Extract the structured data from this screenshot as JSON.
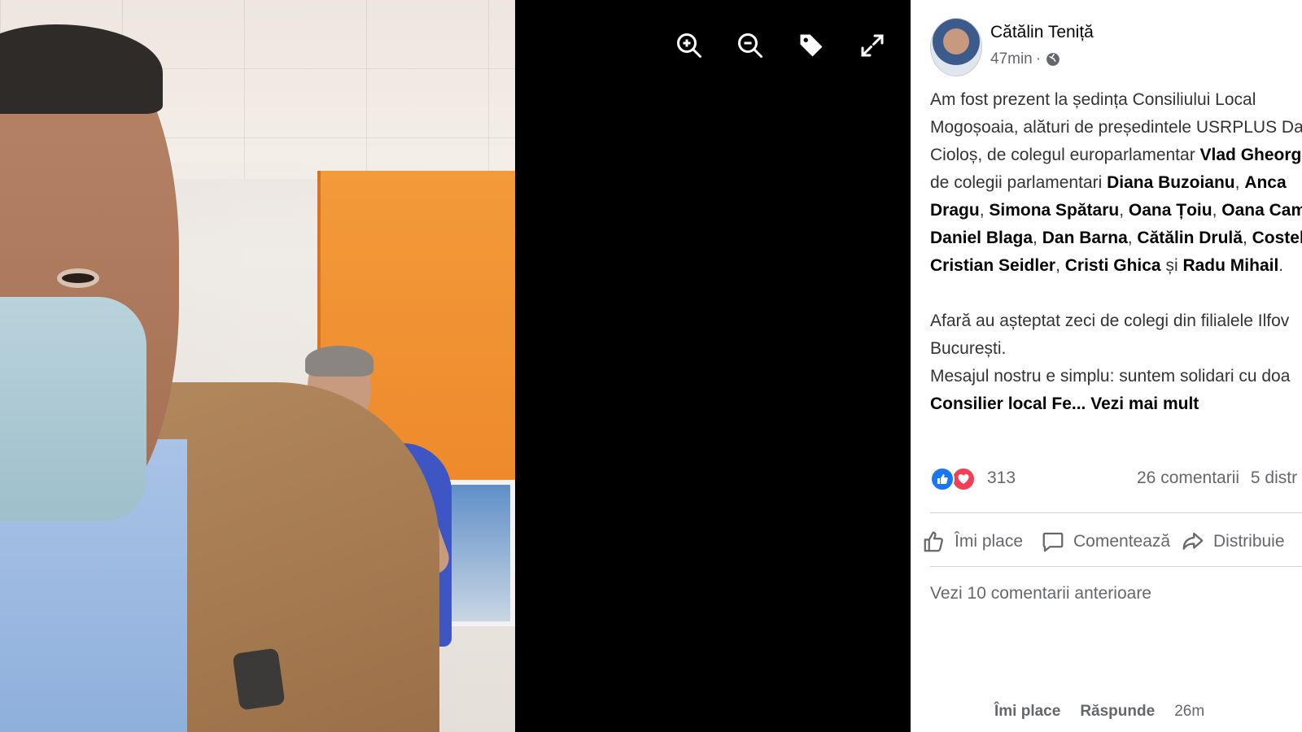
{
  "viewer": {
    "tools": [
      {
        "name": "zoom-in-icon"
      },
      {
        "name": "zoom-out-icon"
      },
      {
        "name": "tag-icon"
      },
      {
        "name": "fullscreen-icon"
      }
    ]
  },
  "post": {
    "author": "Cătălin Teniță",
    "time": "47min",
    "separator": "·",
    "privacy_icon": "globe-icon",
    "text": {
      "p1_l1": "Am fost prezent la ședința Consiliului Local",
      "p1_l2a": "Mogoșoaia, alături de președintele USRPLUS Da",
      "p1_l3a": "Cioloș, de colegul europarlamentar ",
      "p1_l3b": "Vlad Gheorg",
      "p1_l4a": "de colegii parlamentari ",
      "p1_l4b": "Diana Buzoianu",
      "p1_l4c": ", ",
      "p1_l4d": "Anca",
      "p1_l5a": "Dragu",
      "p1_l5b": ", ",
      "p1_l5c": "Simona Spătaru",
      "p1_l5d": ", ",
      "p1_l5e": "Oana Țoiu",
      "p1_l5f": ", ",
      "p1_l5g": "Oana Camb",
      "p1_l6a": "Daniel Blaga",
      "p1_l6b": ", ",
      "p1_l6c": "Dan Barna",
      "p1_l6d": ", ",
      "p1_l6e": "Cătălin Drulă",
      "p1_l6f": ", ",
      "p1_l6g": "Costel V",
      "p1_l7a": "Cristian Seidler",
      "p1_l7b": ", ",
      "p1_l7c": "Cristi Ghica",
      "p1_l7d": " și ",
      "p1_l7e": "Radu Mihail",
      "p1_l7f": ".",
      "p2_l1": "Afară au așteptat zeci de colegi din filialele Ilfov",
      "p2_l2": "București.",
      "p3_l1": "Mesajul nostru e simplu: suntem solidari cu doa",
      "p3_l2a": "Consilier local Fe",
      "p3_l2b": "... ",
      "see_more": "Vezi mai mult"
    },
    "reactions": {
      "like_icon": "like-reaction-icon",
      "love_icon": "love-reaction-icon",
      "count": "313",
      "comments": "26 comentarii",
      "shares": "5 distr"
    },
    "actions": {
      "like": "Îmi place",
      "comment": "Comentează",
      "share": "Distribuie"
    },
    "previous_comments": "Vezi 10 comentarii anterioare",
    "comment": {
      "like": "Îmi place",
      "reply": "Răspunde",
      "time": "26m"
    }
  },
  "colors": {
    "panel_bg": "#ffffff",
    "muted_text": "#65676b",
    "like_blue": "#1877f2",
    "love_red": "#f33e58",
    "viewer_bg": "#000000"
  }
}
